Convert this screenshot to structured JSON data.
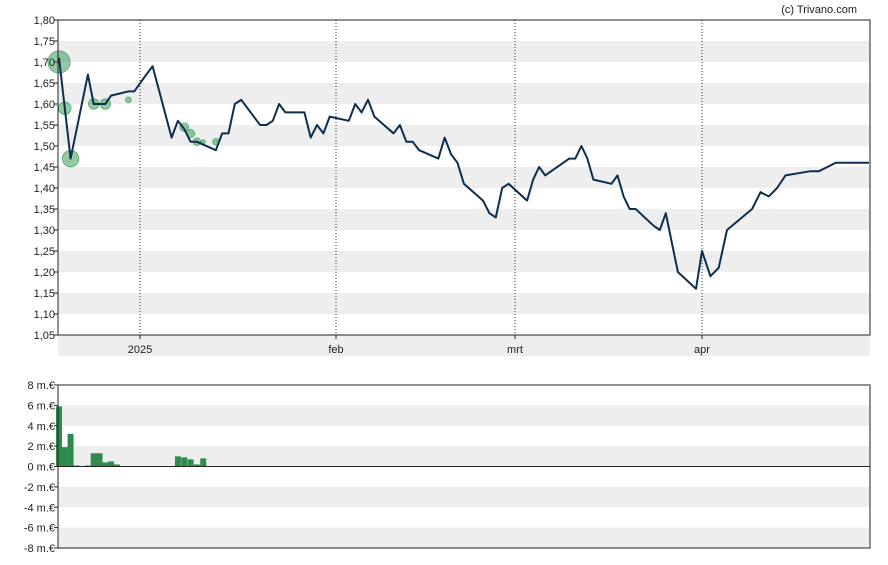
{
  "credit": "(c) Trivano.com",
  "colors": {
    "line": "#0d2e4f",
    "bars": "#2e8b4b",
    "bubbles": "#3a9c57",
    "band": "#eeeeee",
    "frame": "#222222"
  },
  "chart_data": [
    {
      "type": "line",
      "title": "",
      "xlabel": "",
      "ylabel": "",
      "ylim": [
        1.05,
        1.8
      ],
      "y_tick_labels": [
        "1,80",
        "1,75",
        "1,70",
        "1,65",
        "1,60",
        "1,55",
        "1,50",
        "1,45",
        "1,40",
        "1,35",
        "1,30",
        "1,25",
        "1,20",
        "1,15",
        "1,10",
        "1,05"
      ],
      "y_ticks": [
        1.8,
        1.75,
        1.7,
        1.65,
        1.6,
        1.55,
        1.5,
        1.45,
        1.4,
        1.35,
        1.3,
        1.25,
        1.2,
        1.15,
        1.1,
        1.05
      ],
      "x_ticks": [
        {
          "label": "2025",
          "date": "2025-01-01"
        },
        {
          "label": "feb",
          "date": "2025-02-01"
        },
        {
          "label": "mrt",
          "date": "2025-03-01"
        },
        {
          "label": "apr",
          "date": "2025-04-01"
        }
      ],
      "grid": "alternating horizontal bands, dotted vertical lines at month starts",
      "series": [
        {
          "values": [
            [
              "2024-12-18",
              1.71
            ],
            [
              "2024-12-20",
              1.47
            ],
            [
              "2024-12-23",
              1.67
            ],
            [
              "2024-12-24",
              1.6
            ],
            [
              "2024-12-26",
              1.6
            ],
            [
              "2024-12-27",
              1.62
            ],
            [
              "2024-12-30",
              1.63
            ],
            [
              "2024-12-31",
              1.63
            ],
            [
              "2025-01-02",
              1.67
            ],
            [
              "2025-01-03",
              1.69
            ],
            [
              "2025-01-06",
              1.52
            ],
            [
              "2025-01-07",
              1.56
            ],
            [
              "2025-01-08",
              1.54
            ],
            [
              "2025-01-09",
              1.51
            ],
            [
              "2025-01-10",
              1.51
            ],
            [
              "2025-01-13",
              1.49
            ],
            [
              "2025-01-14",
              1.53
            ],
            [
              "2025-01-15",
              1.53
            ],
            [
              "2025-01-16",
              1.6
            ],
            [
              "2025-01-17",
              1.61
            ],
            [
              "2025-01-20",
              1.55
            ],
            [
              "2025-01-21",
              1.55
            ],
            [
              "2025-01-22",
              1.56
            ],
            [
              "2025-01-23",
              1.6
            ],
            [
              "2025-01-24",
              1.58
            ],
            [
              "2025-01-27",
              1.58
            ],
            [
              "2025-01-28",
              1.52
            ],
            [
              "2025-01-29",
              1.55
            ],
            [
              "2025-01-30",
              1.53
            ],
            [
              "2025-01-31",
              1.57
            ],
            [
              "2025-02-03",
              1.56
            ],
            [
              "2025-02-04",
              1.6
            ],
            [
              "2025-02-05",
              1.58
            ],
            [
              "2025-02-06",
              1.61
            ],
            [
              "2025-02-07",
              1.57
            ],
            [
              "2025-02-10",
              1.53
            ],
            [
              "2025-02-11",
              1.55
            ],
            [
              "2025-02-12",
              1.51
            ],
            [
              "2025-02-13",
              1.51
            ],
            [
              "2025-02-14",
              1.49
            ],
            [
              "2025-02-17",
              1.47
            ],
            [
              "2025-02-18",
              1.52
            ],
            [
              "2025-02-19",
              1.48
            ],
            [
              "2025-02-20",
              1.46
            ],
            [
              "2025-02-21",
              1.41
            ],
            [
              "2025-02-24",
              1.37
            ],
            [
              "2025-02-25",
              1.34
            ],
            [
              "2025-02-26",
              1.33
            ],
            [
              "2025-02-27",
              1.4
            ],
            [
              "2025-02-28",
              1.41
            ],
            [
              "2025-03-03",
              1.37
            ],
            [
              "2025-03-04",
              1.42
            ],
            [
              "2025-03-05",
              1.45
            ],
            [
              "2025-03-06",
              1.43
            ],
            [
              "2025-03-07",
              1.44
            ],
            [
              "2025-03-10",
              1.47
            ],
            [
              "2025-03-11",
              1.47
            ],
            [
              "2025-03-12",
              1.5
            ],
            [
              "2025-03-13",
              1.47
            ],
            [
              "2025-03-14",
              1.42
            ],
            [
              "2025-03-17",
              1.41
            ],
            [
              "2025-03-18",
              1.43
            ],
            [
              "2025-03-19",
              1.38
            ],
            [
              "2025-03-20",
              1.35
            ],
            [
              "2025-03-21",
              1.35
            ],
            [
              "2025-03-24",
              1.31
            ],
            [
              "2025-03-25",
              1.3
            ],
            [
              "2025-03-26",
              1.34
            ],
            [
              "2025-03-27",
              1.27
            ],
            [
              "2025-03-28",
              1.2
            ],
            [
              "2025-03-31",
              1.16
            ],
            [
              "2025-04-01",
              1.25
            ],
            [
              "2025-04-02",
              1.19
            ],
            [
              "2025-04-03",
              1.21
            ],
            [
              "2025-04-04",
              1.3
            ],
            [
              "2025-04-07",
              1.35
            ],
            [
              "2025-04-08",
              1.39
            ],
            [
              "2025-04-09",
              1.38
            ],
            [
              "2025-04-10",
              1.4
            ],
            [
              "2025-04-11",
              1.43
            ],
            [
              "2025-04-14",
              1.44
            ],
            [
              "2025-04-15",
              1.44
            ],
            [
              "2025-04-16",
              1.45
            ],
            [
              "2025-04-17",
              1.46
            ],
            [
              "2025-04-21",
              1.46
            ]
          ]
        }
      ],
      "bubbles": [
        {
          "date": "2024-12-18",
          "value": 1.7,
          "size": 5.9
        },
        {
          "date": "2024-12-19",
          "value": 1.59,
          "size": 1.9
        },
        {
          "date": "2024-12-20",
          "value": 1.47,
          "size": 3.2
        },
        {
          "date": "2024-12-24",
          "value": 1.6,
          "size": 1.3
        },
        {
          "date": "2024-12-26",
          "value": 1.6,
          "size": 1.3
        },
        {
          "date": "2024-12-30",
          "value": 1.61,
          "size": 0.4
        },
        {
          "date": "2025-01-08",
          "value": 1.545,
          "size": 0.9
        },
        {
          "date": "2025-01-09",
          "value": 1.53,
          "size": 0.8
        },
        {
          "date": "2025-01-10",
          "value": 1.51,
          "size": 0.7
        },
        {
          "date": "2025-01-11",
          "value": 1.51,
          "size": 0.2
        },
        {
          "date": "2025-01-13",
          "value": 1.51,
          "size": 0.5
        }
      ]
    },
    {
      "type": "bar",
      "title": "",
      "xlabel": "",
      "ylabel": "",
      "ylim": [
        -8,
        8
      ],
      "y_tick_labels": [
        "8 m.€",
        "6 m.€",
        "4 m.€",
        "2 m.€",
        "0 m.€",
        "-2 m.€",
        "-4 m.€",
        "-6 m.€",
        "-8 m.€"
      ],
      "y_ticks": [
        8,
        6,
        4,
        2,
        0,
        -2,
        -4,
        -6,
        -8
      ],
      "values": [
        [
          "2024-12-18",
          5.9
        ],
        [
          "2024-12-19",
          1.9
        ],
        [
          "2024-12-20",
          3.2
        ],
        [
          "2024-12-21",
          0.1
        ],
        [
          "2024-12-23",
          0.1
        ],
        [
          "2024-12-24",
          1.3
        ],
        [
          "2024-12-25",
          1.3
        ],
        [
          "2024-12-26",
          0.4
        ],
        [
          "2024-12-27",
          0.5
        ],
        [
          "2024-12-28",
          0.2
        ],
        [
          "2025-01-07",
          1.0
        ],
        [
          "2025-01-08",
          0.9
        ],
        [
          "2025-01-09",
          0.7
        ],
        [
          "2025-01-10",
          0.2
        ],
        [
          "2025-01-11",
          0.8
        ]
      ]
    }
  ]
}
